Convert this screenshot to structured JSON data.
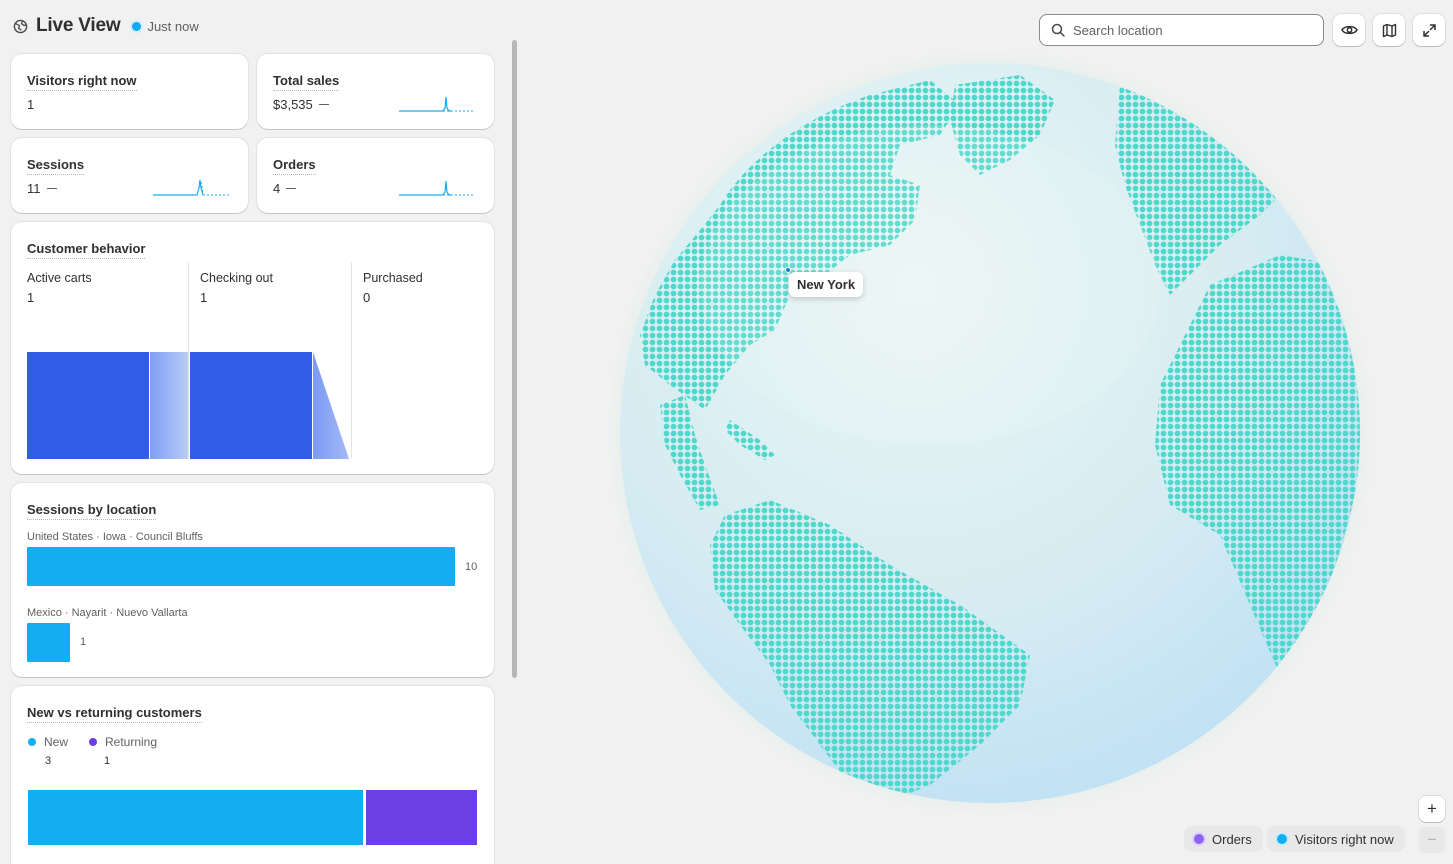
{
  "header": {
    "title": "Live View",
    "status": "Just now"
  },
  "metrics": {
    "visitors": {
      "label": "Visitors right now",
      "value": "1"
    },
    "total_sales": {
      "label": "Total sales",
      "value": "$3,535"
    },
    "sessions": {
      "label": "Sessions",
      "value": "11"
    },
    "orders": {
      "label": "Orders",
      "value": "4"
    }
  },
  "customer_behavior": {
    "title": "Customer behavior",
    "columns": [
      {
        "label": "Active carts",
        "value": "1"
      },
      {
        "label": "Checking out",
        "value": "1"
      },
      {
        "label": "Purchased",
        "value": "0"
      }
    ]
  },
  "sessions_by_location": {
    "title": "Sessions by location",
    "rows": [
      {
        "label": "United States · Iowa · Council Bluffs",
        "count": "10"
      },
      {
        "label": "Mexico · Nayarit · Nuevo Vallarta",
        "count": "1"
      }
    ]
  },
  "new_vs_returning": {
    "title": "New vs returning customers",
    "new_label": "New",
    "new_value": "3",
    "returning_label": "Returning",
    "returning_value": "1"
  },
  "map": {
    "search_placeholder": "Search location",
    "tooltip": "New York",
    "legend_orders": "Orders",
    "legend_visitors": "Visitors right now",
    "zoom_in": "+",
    "zoom_out": "−"
  },
  "colors": {
    "accent_blue": "#13aef0",
    "funnel_blue": "#2f5de8",
    "returning_purple": "#6a3fe6",
    "land_teal": "#4fd8cc"
  },
  "icons": {
    "header": "globe-icon",
    "search": "search-icon",
    "eye": "eye-icon",
    "map": "map-icon",
    "expand": "expand-icon"
  }
}
